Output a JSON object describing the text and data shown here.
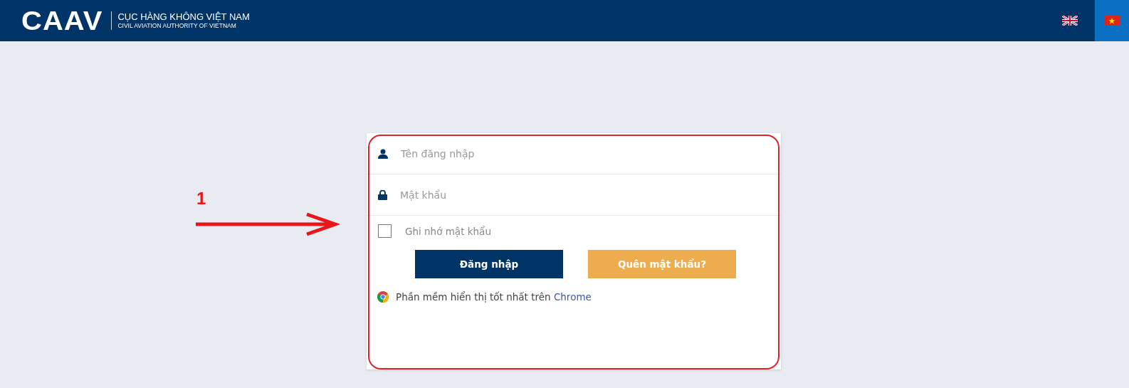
{
  "header": {
    "logo": "CAAV",
    "title": "CỤC HÀNG KHÔNG VIỆT NAM",
    "subtitle": "CIVIL AVIATION AUTHORITY OF VIETNAM"
  },
  "languages": [
    {
      "kind": "uk",
      "selected": false
    },
    {
      "kind": "vn",
      "selected": true
    }
  ],
  "annotation": {
    "label": "1"
  },
  "login": {
    "username": {
      "placeholder": "Tên đăng nhập"
    },
    "password": {
      "placeholder": "Mật khẩu"
    },
    "remember": {
      "label": "Ghi nhớ mật khẩu",
      "checked": false
    },
    "buttons": [
      {
        "kind": "primary",
        "label": "Đăng nhập"
      },
      {
        "kind": "secondary",
        "label": "Quên mật khẩu?"
      }
    ],
    "note": {
      "text": "Phần mềm hiển thị tốt nhất trên",
      "link": "Chrome"
    }
  }
}
